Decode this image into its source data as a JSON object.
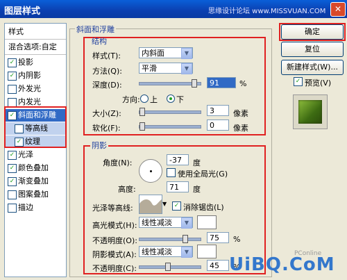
{
  "window": {
    "title": "图层样式",
    "watermark": "思缘设计论坛 www.MISSVUAN.COM",
    "close": "✕"
  },
  "styles_list": {
    "header": "样式",
    "blend_options": "混合选项:自定",
    "items": [
      {
        "label": "投影",
        "checked": true
      },
      {
        "label": "内阴影",
        "checked": true
      },
      {
        "label": "外发光",
        "checked": false
      },
      {
        "label": "内发光",
        "checked": false
      },
      {
        "label": "斜面和浮雕",
        "checked": true
      },
      {
        "label": "等高线",
        "checked": false
      },
      {
        "label": "纹理",
        "checked": true
      },
      {
        "label": "光泽",
        "checked": true
      },
      {
        "label": "颜色叠加",
        "checked": true
      },
      {
        "label": "渐变叠加",
        "checked": true
      },
      {
        "label": "图案叠加",
        "checked": false
      },
      {
        "label": "描边",
        "checked": false
      }
    ]
  },
  "bevel": {
    "title": "斜面和浮雕",
    "structure": {
      "title": "结构",
      "style_label": "样式(T):",
      "style_value": "内斜面",
      "technique_label": "方法(Q):",
      "technique_value": "平滑",
      "depth_label": "深度(D):",
      "depth_value": "91",
      "depth_unit": "%",
      "depth_fraction": 0.91,
      "direction_label": "方向:",
      "dir_up": "上",
      "dir_down": "下",
      "size_label": "大小(Z):",
      "size_value": "3",
      "size_unit": "像素",
      "soften_label": "软化(F):",
      "soften_value": "0",
      "soften_unit": "像素"
    },
    "shading": {
      "title": "阴影",
      "angle_label": "角度(N):",
      "angle_value": "-37",
      "angle_unit": "度",
      "global_light_label": "使用全局光(G)",
      "altitude_label": "高度:",
      "altitude_value": "71",
      "altitude_unit": "度",
      "gloss_label": "光泽等高线:",
      "antialias_label": "消除锯齿(L)",
      "highlight_label": "高光模式(H):",
      "highlight_value": "线性减淡",
      "hl_opacity_label": "不透明度(O):",
      "hl_opacity_value": "75",
      "hl_opacity_fraction": 0.75,
      "pct": "%",
      "shadow_label": "阴影模式(A):",
      "shadow_value": "线性减淡",
      "sh_opacity_label": "不透明度(C):",
      "sh_opacity_value": "45",
      "sh_opacity_fraction": 0.45
    }
  },
  "buttons": {
    "ok": "确定",
    "reset": "复位",
    "new_style": "新建样式(W)...",
    "preview": "预览(V)"
  },
  "brand": "UiBQ.CoM",
  "brand_small": "PConline"
}
